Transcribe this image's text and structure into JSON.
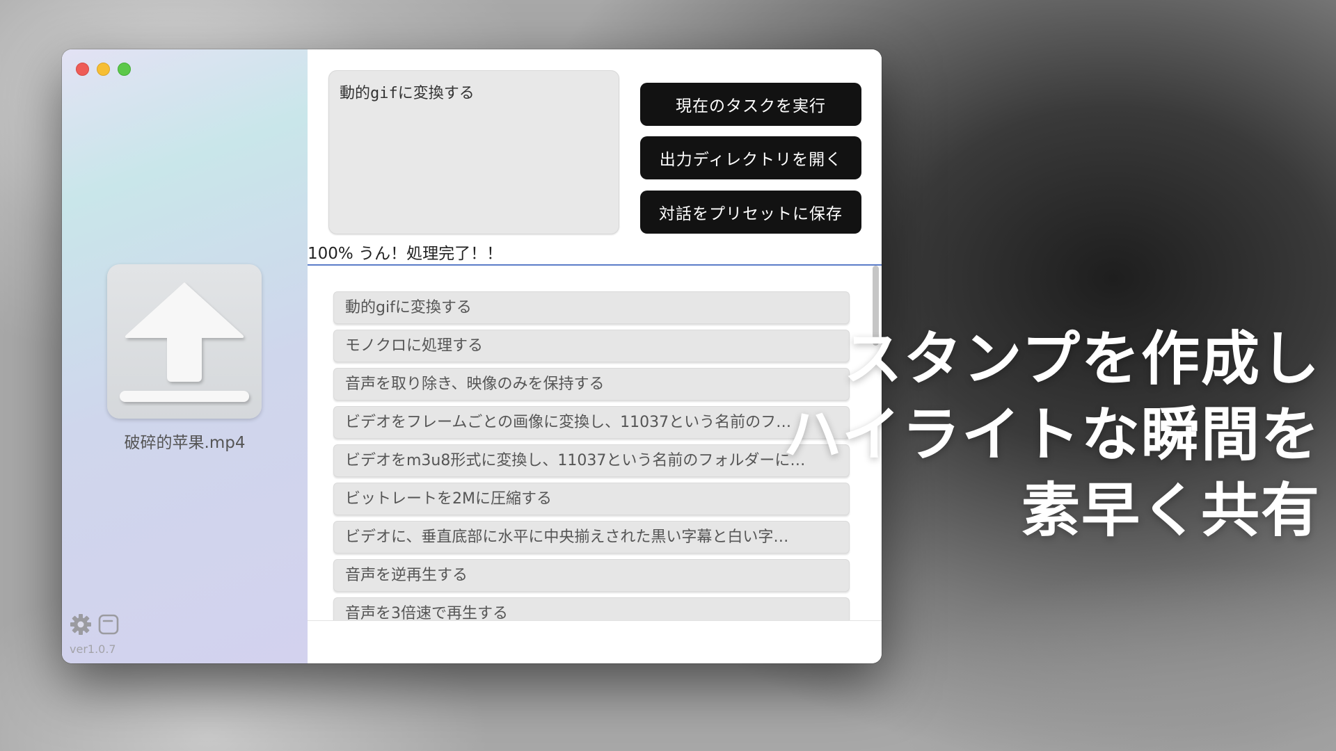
{
  "window": {
    "traffic_lights": [
      "close",
      "minimize",
      "maximize"
    ]
  },
  "sidebar": {
    "upload_icon": "upload-icon",
    "file_name": "破碎的苹果.mp4",
    "settings_icon": "gear-icon",
    "window_icon": "window-icon",
    "version": "ver1.0.7"
  },
  "main": {
    "prompt_text": "動的gifに変換する",
    "buttons": {
      "run": "現在のタスクを実行",
      "open_output": "出力ディレクトリを開く",
      "save_preset": "対話をプリセットに保存"
    },
    "status": "100% うん！処理完了！！",
    "progress": 1.0,
    "tasks": [
      "動的gifに変換する",
      "モノクロに処理する",
      "音声を取り除き、映像のみを保持する",
      "ビデオをフレームごとの画像に変換し、11037という名前のフ…",
      "ビデオをm3u8形式に変換し、11037という名前のフォルダーに…",
      "ビットレートを2Mに圧縮する",
      "ビデオに、垂直底部に水平に中央揃えされた黒い字幕と白い字…",
      "音声を逆再生する",
      "音声を3倍速で再生する"
    ]
  },
  "headline": {
    "line1": "スタンプを作成し",
    "line2": "ハイライトな瞬間を",
    "line3": "素早く共有"
  },
  "colors": {
    "button_bg": "#121212",
    "progress": "#5a7cc8",
    "close": "#ee5c57",
    "minimize": "#f6be34",
    "maximize": "#5cc84a"
  }
}
